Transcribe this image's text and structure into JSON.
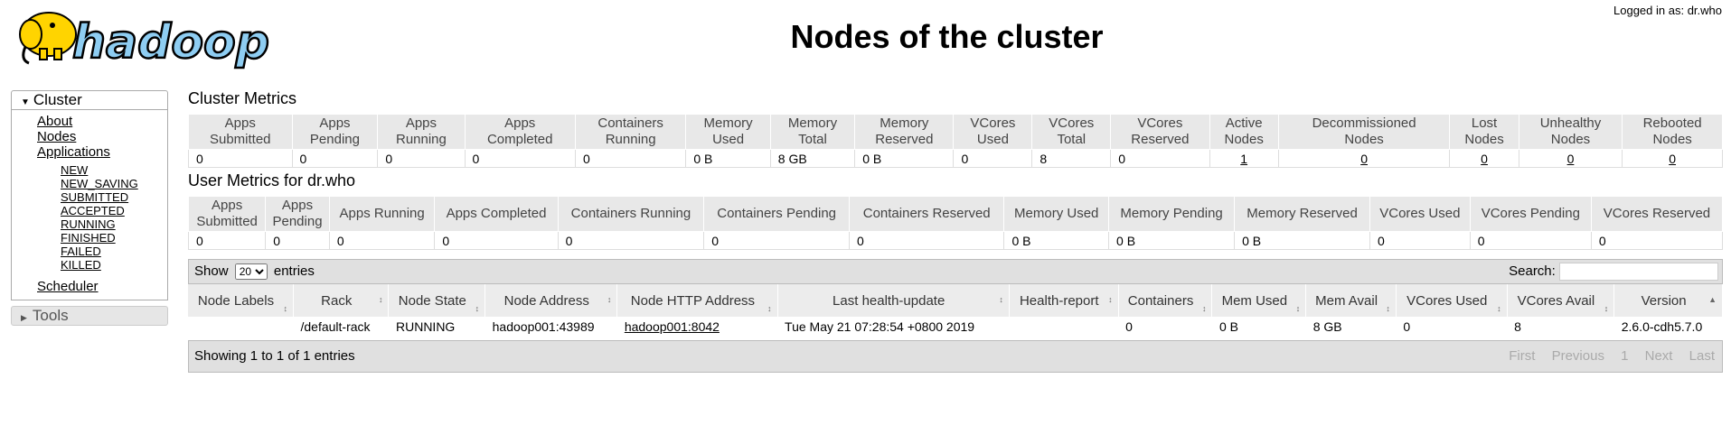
{
  "header": {
    "logo_text": "hadoop",
    "title": "Nodes of the cluster",
    "login_text": "Logged in as: dr.who"
  },
  "sidebar": {
    "cluster_label": "Cluster",
    "links": [
      "About",
      "Nodes",
      "Applications"
    ],
    "app_states": [
      "NEW",
      "NEW_SAVING",
      "SUBMITTED",
      "ACCEPTED",
      "RUNNING",
      "FINISHED",
      "FAILED",
      "KILLED"
    ],
    "scheduler": "Scheduler",
    "tools_label": "Tools"
  },
  "cluster_metrics": {
    "title": "Cluster Metrics",
    "headers": [
      [
        "Apps",
        "Submitted"
      ],
      [
        "Apps",
        "Pending"
      ],
      [
        "Apps",
        "Running"
      ],
      [
        "Apps",
        "Completed"
      ],
      [
        "Containers",
        "Running"
      ],
      [
        "Memory",
        "Used"
      ],
      [
        "Memory",
        "Total"
      ],
      [
        "Memory",
        "Reserved"
      ],
      [
        "VCores",
        "Used"
      ],
      [
        "VCores",
        "Total"
      ],
      [
        "VCores",
        "Reserved"
      ],
      [
        "Active",
        "Nodes"
      ],
      [
        "Decommissioned",
        "Nodes"
      ],
      [
        "Lost",
        "Nodes"
      ],
      [
        "Unhealthy",
        "Nodes"
      ],
      [
        "Rebooted",
        "Nodes"
      ]
    ],
    "values": [
      "0",
      "0",
      "0",
      "0",
      "0",
      "0 B",
      "8 GB",
      "0 B",
      "0",
      "8",
      "0",
      "1",
      "0",
      "0",
      "0",
      "0"
    ]
  },
  "user_metrics": {
    "title": "User Metrics for dr.who",
    "headers": [
      [
        "Apps",
        "Submitted"
      ],
      [
        "Apps",
        "Pending"
      ],
      [
        "Apps Running"
      ],
      [
        "Apps Completed"
      ],
      [
        "Containers Running"
      ],
      [
        "Containers Pending"
      ],
      [
        "Containers Reserved"
      ],
      [
        "Memory Used"
      ],
      [
        "Memory Pending"
      ],
      [
        "Memory Reserved"
      ],
      [
        "VCores Used"
      ],
      [
        "VCores Pending"
      ],
      [
        "VCores Reserved"
      ]
    ],
    "values": [
      "0",
      "0",
      "0",
      "0",
      "0",
      "0",
      "0",
      "0 B",
      "0 B",
      "0 B",
      "0",
      "0",
      "0"
    ]
  },
  "table_controls": {
    "show_label": "Show",
    "page_size": "20",
    "entries_label": "entries",
    "search_label": "Search:",
    "search_value": ""
  },
  "nodes": {
    "headers": [
      "Node Labels",
      "Rack",
      "Node State",
      "Node Address",
      "Node HTTP Address",
      "Last health-update",
      "Health-report",
      "Containers",
      "Mem Used",
      "Mem Avail",
      "VCores Used",
      "VCores Avail",
      "Version"
    ],
    "rows": [
      [
        "",
        "/default-rack",
        "RUNNING",
        "hadoop001:43989",
        "hadoop001:8042",
        "Tue May 21 07:28:54 +0800 2019",
        "",
        "0",
        "0 B",
        "8 GB",
        "0",
        "8",
        "2.6.0-cdh5.7.0"
      ]
    ]
  },
  "footer": {
    "info": "Showing 1 to 1 of 1 entries",
    "pager": [
      "First",
      "Previous",
      "1",
      "Next",
      "Last"
    ]
  },
  "colors": {
    "logo_fill": "#8ecdf2",
    "logo_yellow": "#ffd400"
  }
}
